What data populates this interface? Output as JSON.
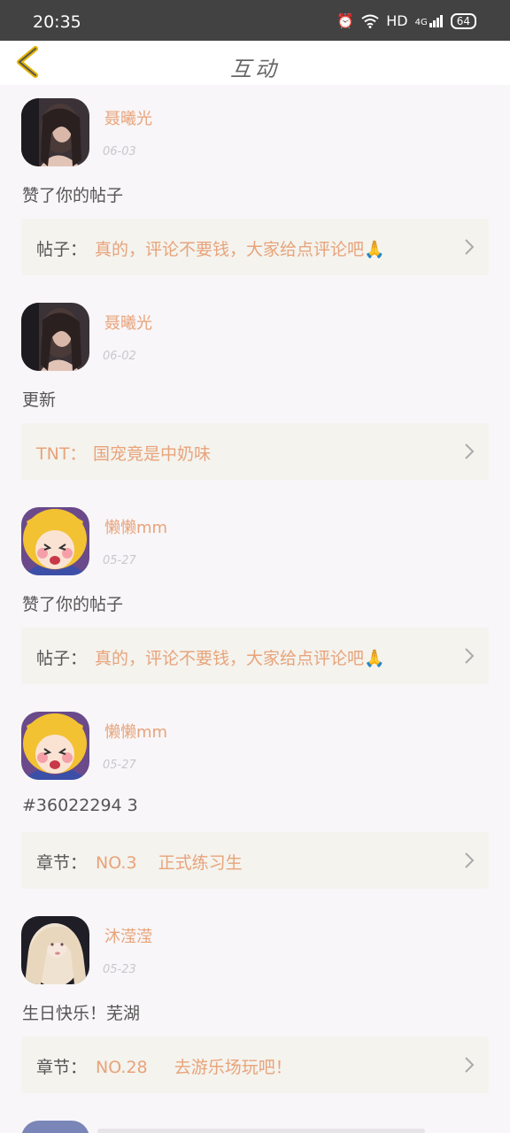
{
  "status_bar": {
    "time": "20:35",
    "hd": "HD",
    "network": "4G",
    "battery": "64"
  },
  "header": {
    "title": "互动"
  },
  "feed": [
    {
      "username": "聂曦光",
      "date": "06-03",
      "action": "赞了你的帖子",
      "ref_prefix": "帖子：",
      "ref_text": "真的，评论不要钱，大家给点评论吧🙏"
    },
    {
      "username": "聂曦光",
      "date": "06-02",
      "action": "更新",
      "ref_prefix": "TNT：",
      "ref_text": "国宠竟是中奶味"
    },
    {
      "username": "懒懒mm",
      "date": "05-27",
      "action": "赞了你的帖子",
      "ref_prefix": "帖子：",
      "ref_text": "真的，评论不要钱，大家给点评论吧🙏"
    },
    {
      "username": "懒懒mm",
      "date": "05-27",
      "action": "#36022294 3",
      "ref_prefix": "章节：",
      "ref_text": "NO.3    正式练习生"
    },
    {
      "username": "沐滢滢",
      "date": "05-23",
      "action": "生日快乐！芜湖",
      "ref_prefix": "章节：",
      "ref_text": "NO.28     去游乐场玩吧！"
    }
  ]
}
